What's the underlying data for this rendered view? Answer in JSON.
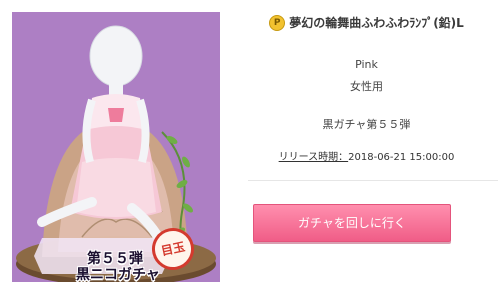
{
  "item": {
    "title": "夢幻の輪舞曲ふわふわﾗﾝﾌﾟ(鉛)L",
    "currency_icon": "p-coin-icon",
    "currency_symbol": "P",
    "color": "Pink",
    "gender": "女性用",
    "series": "黒ガチャ第５５弾",
    "release_label": "リリース時期：",
    "release_date": "2018-06-21 15:00:00"
  },
  "thumbnail": {
    "banner_line1": "第５５弾",
    "banner_line2": "黒ニコガチャ",
    "seal_text": "目玉",
    "background_color": "#ad7fc4"
  },
  "actions": {
    "gacha_button": "ガチャを回しに行く",
    "button_color": "#f26a90"
  }
}
